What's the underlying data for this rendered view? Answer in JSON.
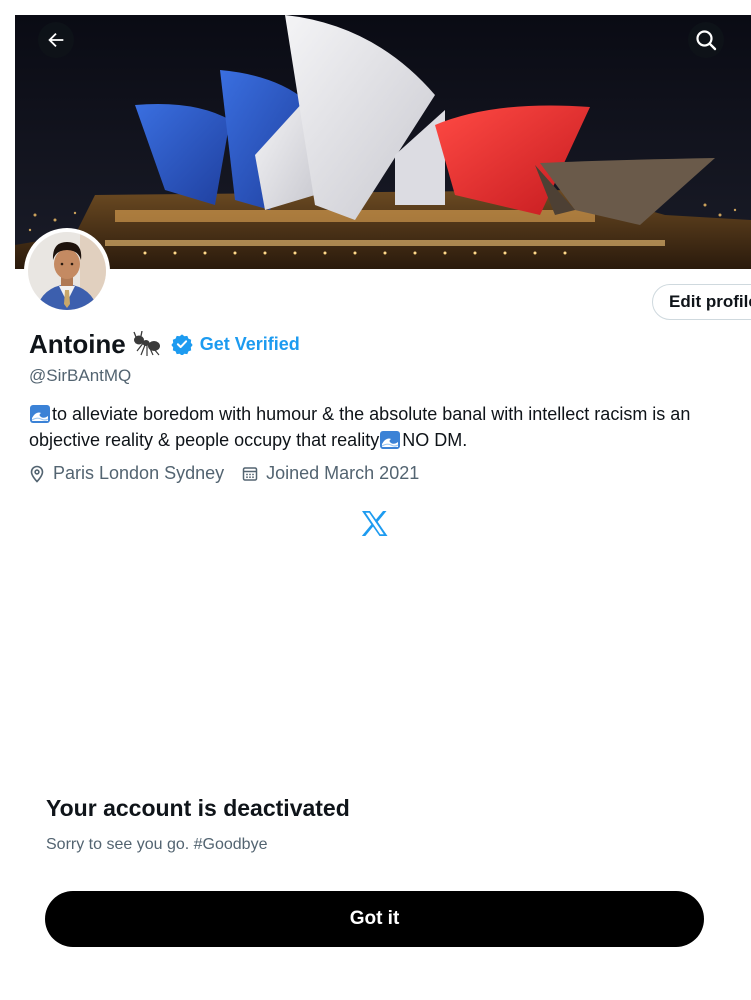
{
  "header": {
    "back_icon": "arrow-left-icon",
    "search_icon": "search-icon"
  },
  "profile": {
    "display_name": "Antoine",
    "name_emoji_icon": "ant-icon",
    "verified_icon": "verified-badge-icon",
    "get_verified_label": "Get Verified",
    "handle": "@SirBAntMQ",
    "edit_button_label": "Edit profile",
    "bio_line1": "to alleviate boredom with humour & the absolute banal with intellect  racism is an",
    "bio_line2_a": "objective reality & people occupy that reality",
    "bio_line2_b": " NO DM.",
    "bio_emoji_icon": "water-wave-icon",
    "location": "Paris London Sydney",
    "location_icon": "location-pin-icon",
    "joined": "Joined March 2021",
    "joined_icon": "calendar-icon"
  },
  "brand": {
    "logo_icon": "x-logo-icon",
    "accent_color": "#1d9bf0"
  },
  "dialog": {
    "title": "Your account is deactivated",
    "subtitle": "Sorry to see you go. #Goodbye",
    "button_label": "Got it"
  }
}
